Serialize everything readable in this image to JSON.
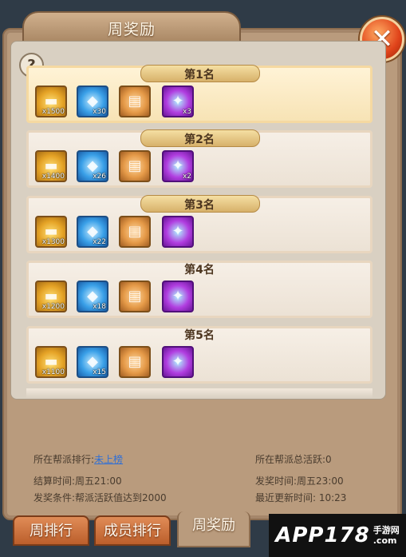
{
  "window": {
    "title": "周奖励",
    "close_icon": "close-x"
  },
  "help_label": "?",
  "ranks": [
    {
      "label": "第1名",
      "items": [
        {
          "icon": "gold-ingot-icon",
          "count": "x1500"
        },
        {
          "icon": "blue-stone-icon",
          "count": "x30"
        },
        {
          "icon": "book-icon",
          "count": ""
        },
        {
          "icon": "gem-icon",
          "count": "x3"
        }
      ]
    },
    {
      "label": "第2名",
      "items": [
        {
          "icon": "gold-ingot-icon",
          "count": "x1400"
        },
        {
          "icon": "blue-stone-icon",
          "count": "x26"
        },
        {
          "icon": "book-icon",
          "count": ""
        },
        {
          "icon": "gem-icon",
          "count": "x2"
        }
      ]
    },
    {
      "label": "第3名",
      "items": [
        {
          "icon": "gold-ingot-icon",
          "count": "x1300"
        },
        {
          "icon": "blue-stone-icon",
          "count": "x22"
        },
        {
          "icon": "book-icon",
          "count": ""
        },
        {
          "icon": "gem-icon",
          "count": ""
        }
      ]
    },
    {
      "label": "第4名",
      "items": [
        {
          "icon": "gold-ingot-icon",
          "count": "x1200"
        },
        {
          "icon": "blue-stone-icon",
          "count": "x18"
        },
        {
          "icon": "book-icon",
          "count": ""
        },
        {
          "icon": "gem-icon",
          "count": ""
        }
      ]
    },
    {
      "label": "第5名",
      "items": [
        {
          "icon": "gold-ingot-icon",
          "count": "x1100"
        },
        {
          "icon": "blue-stone-icon",
          "count": "x15"
        },
        {
          "icon": "book-icon",
          "count": ""
        },
        {
          "icon": "gem-icon",
          "count": ""
        }
      ]
    }
  ],
  "info": {
    "rank_label": "所在帮派排行:",
    "rank_value": "未上榜",
    "settle_time": "结算时间:周五21:00",
    "condition": "发奖条件:帮派活跃值达到2000",
    "total_activity": "所在帮派总活跃:0",
    "reward_time": "发奖时间:周五23:00",
    "last_update": "最近更新时间: 10:23"
  },
  "tabs": [
    {
      "label": "周排行",
      "active": false
    },
    {
      "label": "成员排行",
      "active": false
    },
    {
      "label": "周奖励",
      "active": true
    }
  ],
  "watermark": {
    "main": "APP178",
    "sub1": "手游网",
    "sub2": ".com"
  },
  "colors": {
    "accent": "#e05a2a",
    "link": "#2f6fd6",
    "panel": "#b99b7d"
  }
}
